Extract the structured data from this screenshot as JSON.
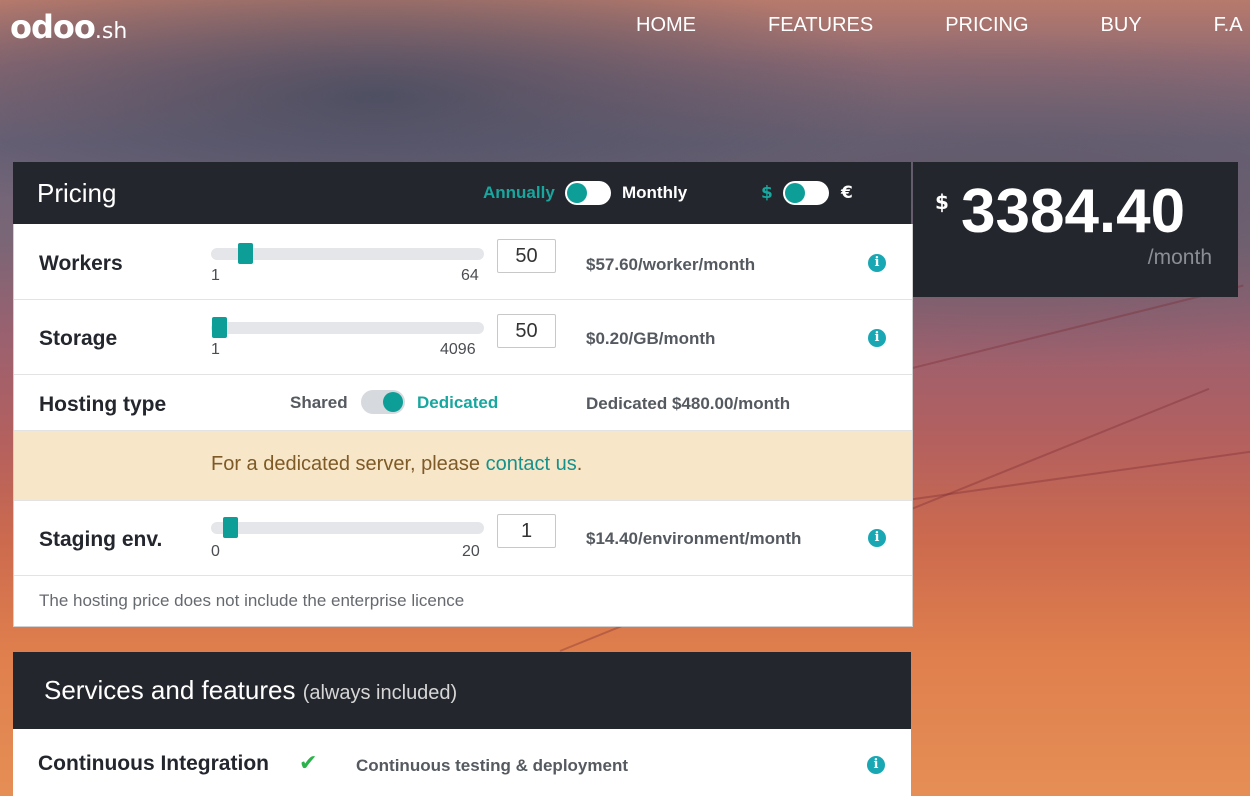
{
  "nav": {
    "logo_main": "odoo",
    "logo_suffix": ".sh",
    "items": [
      "HOME",
      "FEATURES",
      "PRICING",
      "BUY",
      "F.A"
    ]
  },
  "pricing": {
    "title": "Pricing",
    "billing_annual": "Annually",
    "billing_monthly": "Monthly",
    "billing_selected": "Annually",
    "currency_usd": "$",
    "currency_eur": "€",
    "currency_selected": "$",
    "total_currency": "$",
    "total_value": "3384.40",
    "total_period": "/month",
    "rows": {
      "workers": {
        "label": "Workers",
        "min": "1",
        "max": "64",
        "value": "50",
        "slider_fraction": 0.13,
        "rate": "$57.60/worker/month"
      },
      "storage": {
        "label": "Storage",
        "min": "1",
        "max": "4096",
        "value": "50",
        "slider_fraction": 0.0,
        "rate": "$0.20/GB/month"
      },
      "hosting": {
        "label": "Hosting type",
        "option_shared": "Shared",
        "option_dedicated": "Dedicated",
        "selected": "Dedicated",
        "rate": "Dedicated $480.00/month"
      },
      "staging": {
        "label": "Staging env.",
        "min": "0",
        "max": "20",
        "value": "1",
        "slider_fraction": 0.05,
        "rate": "$14.40/environment/month"
      }
    },
    "alert_text": "For a dedicated server, please ",
    "alert_link": "contact us",
    "alert_end": ".",
    "footnote": "The hosting price does not include the enterprise licence"
  },
  "services": {
    "title": "Services and features",
    "subtitle": "(always included)",
    "items": [
      {
        "label": "Continuous Integration",
        "icon": "check-icon",
        "description": "Continuous testing & deployment"
      }
    ]
  },
  "colors": {
    "accent": "#0c9e97",
    "dark": "#23262d",
    "alert_bg": "#f8e6c9",
    "info": "#1aa7b4"
  }
}
